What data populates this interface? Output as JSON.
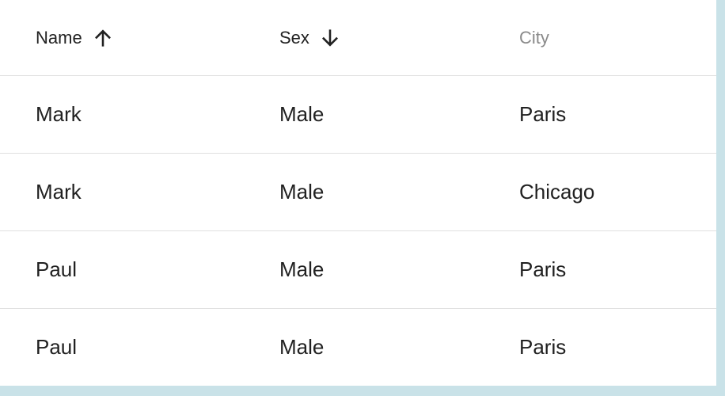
{
  "table": {
    "columns": [
      {
        "label": "Name",
        "sort": "ascending",
        "sort_icon": "arrow-up-icon"
      },
      {
        "label": "Sex",
        "sort": "descending",
        "sort_icon": "arrow-down-icon"
      },
      {
        "label": "City",
        "sort": "none"
      }
    ],
    "rows": [
      {
        "name": "Mark",
        "sex": "Male",
        "city": "Paris"
      },
      {
        "name": "Mark",
        "sex": "Male",
        "city": "Chicago"
      },
      {
        "name": "Paul",
        "sex": "Male",
        "city": "Paris"
      },
      {
        "name": "Paul",
        "sex": "Male",
        "city": "Paris"
      }
    ]
  },
  "colors": {
    "background": "#c9e2e8",
    "card": "#ffffff",
    "text": "#212121",
    "inactive_header": "#8a8a8a",
    "divider": "#e0e0e0"
  }
}
